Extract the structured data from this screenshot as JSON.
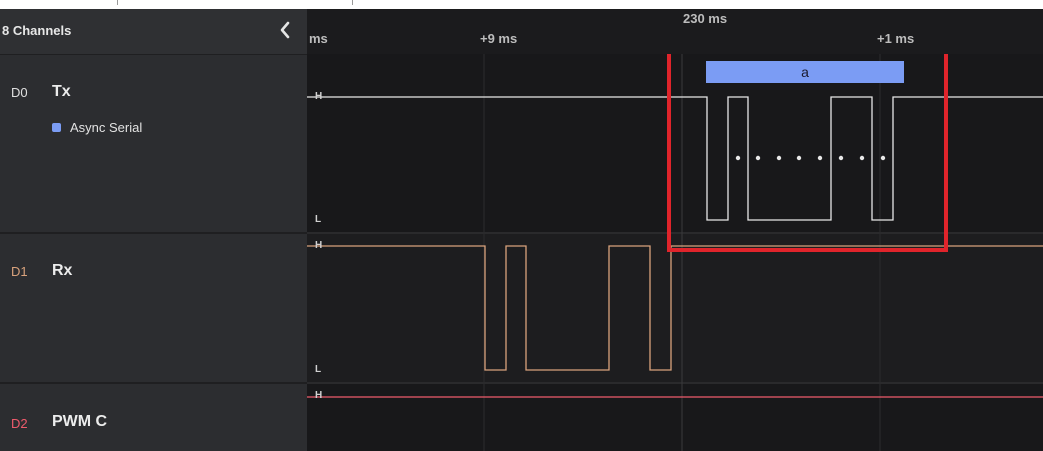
{
  "sidebar": {
    "title": "8 Channels",
    "channels": [
      {
        "id": "D0",
        "name": "Tx",
        "color": "#e8e8e8",
        "analyzer": "Async Serial"
      },
      {
        "id": "D1",
        "name": "Rx",
        "color": "#d9a27c"
      },
      {
        "id": "D2",
        "name": "PWM C",
        "color": "#ef5b6c"
      }
    ]
  },
  "timeline": {
    "left_partial": "ms",
    "mid": "+9 ms",
    "center": "230 ms",
    "right": "+1 ms"
  },
  "levels": {
    "high": "H",
    "low": "L"
  },
  "decoded_frame": {
    "value": "a",
    "color": "#7b9cf4"
  },
  "highlight_color": "#e0242b"
}
